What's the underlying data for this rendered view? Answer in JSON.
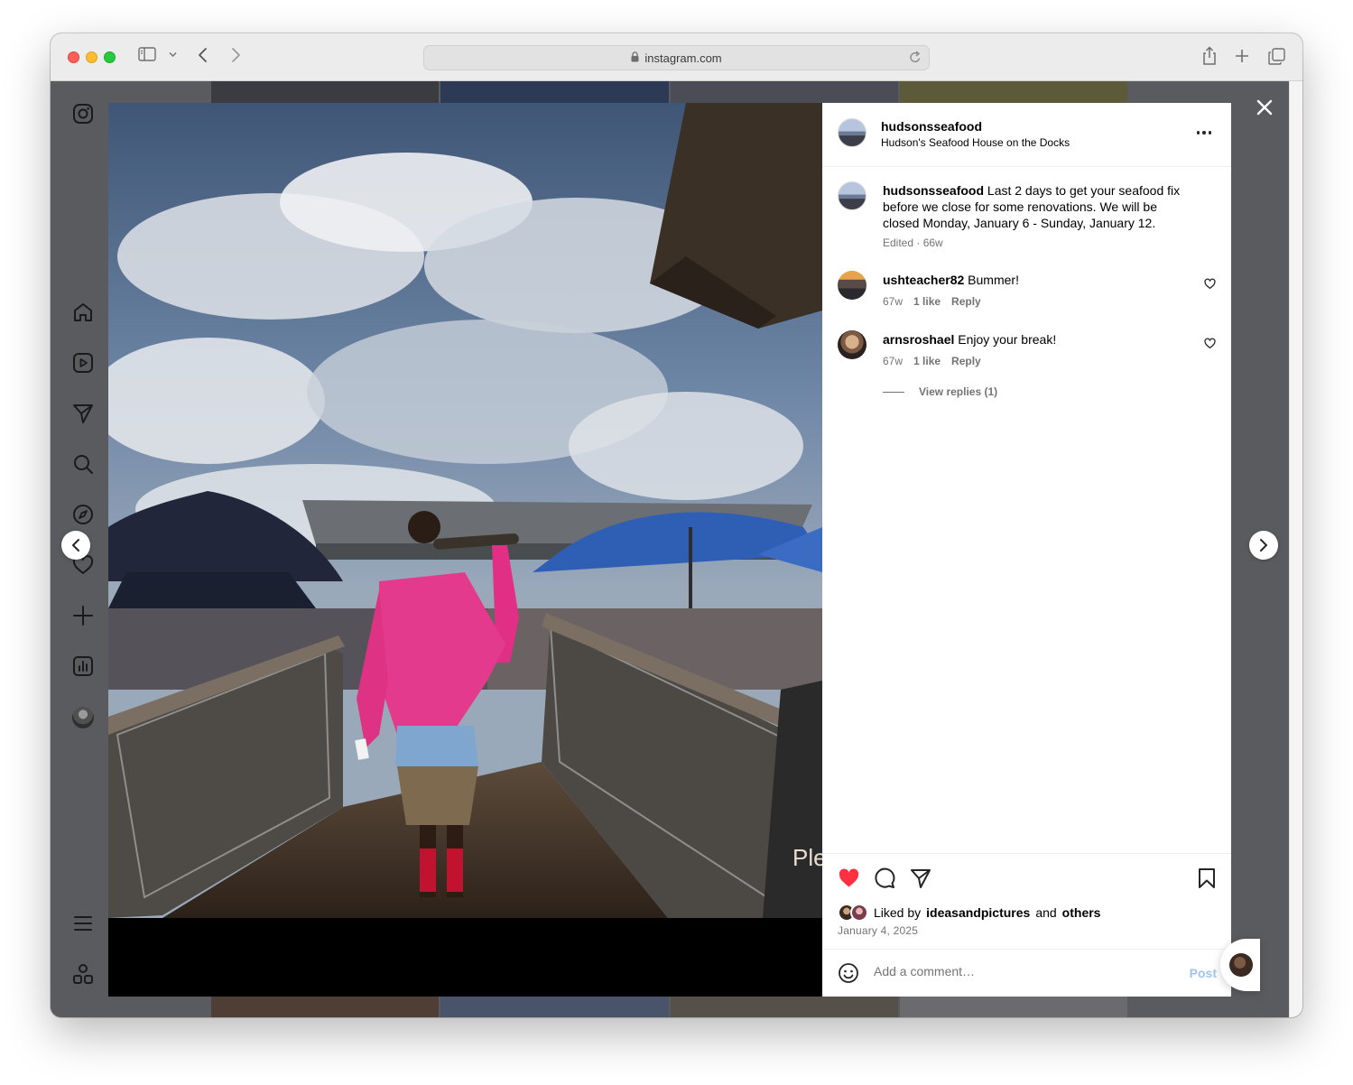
{
  "browser": {
    "url": "instagram.com"
  },
  "post": {
    "username": "hudsonsseafood",
    "location": "Hudson's Seafood House on the Docks",
    "caption_user": "hudsonsseafood",
    "caption_text": "Last 2 days to get your seafood fix before we close for some renovations. We will be closed Monday, January 6 - Sunday, January 12.",
    "caption_meta": "Edited · 66w",
    "comments": [
      {
        "user": "ushteacher82",
        "text": "Bummer!",
        "age": "67w",
        "likes": "1 like",
        "reply": "Reply"
      },
      {
        "user": "arnsroshael",
        "text": "Enjoy your break!",
        "age": "67w",
        "likes": "1 like",
        "reply": "Reply"
      }
    ],
    "view_replies": "View replies (1)",
    "liked_prefix": "Liked by",
    "liked_user": "ideasandpictures",
    "liked_and": "and",
    "liked_others": "others",
    "date": "January 4, 2025",
    "add_comment_placeholder": "Add a comment…",
    "post_label": "Post",
    "photo_sign_text": "Ple For TC"
  },
  "colors": {
    "like_red": "#ff3040",
    "post_blue": "#9fc3f5",
    "backdrop": "#5a5b5f"
  },
  "icons": {
    "nav": [
      "instagram-logo-icon",
      "home-icon",
      "reels-icon",
      "messages-icon",
      "search-icon",
      "explore-icon",
      "notifications-icon",
      "create-icon",
      "dashboard-icon",
      "profile-avatar",
      "menu-icon",
      "more-apps-icon"
    ]
  }
}
